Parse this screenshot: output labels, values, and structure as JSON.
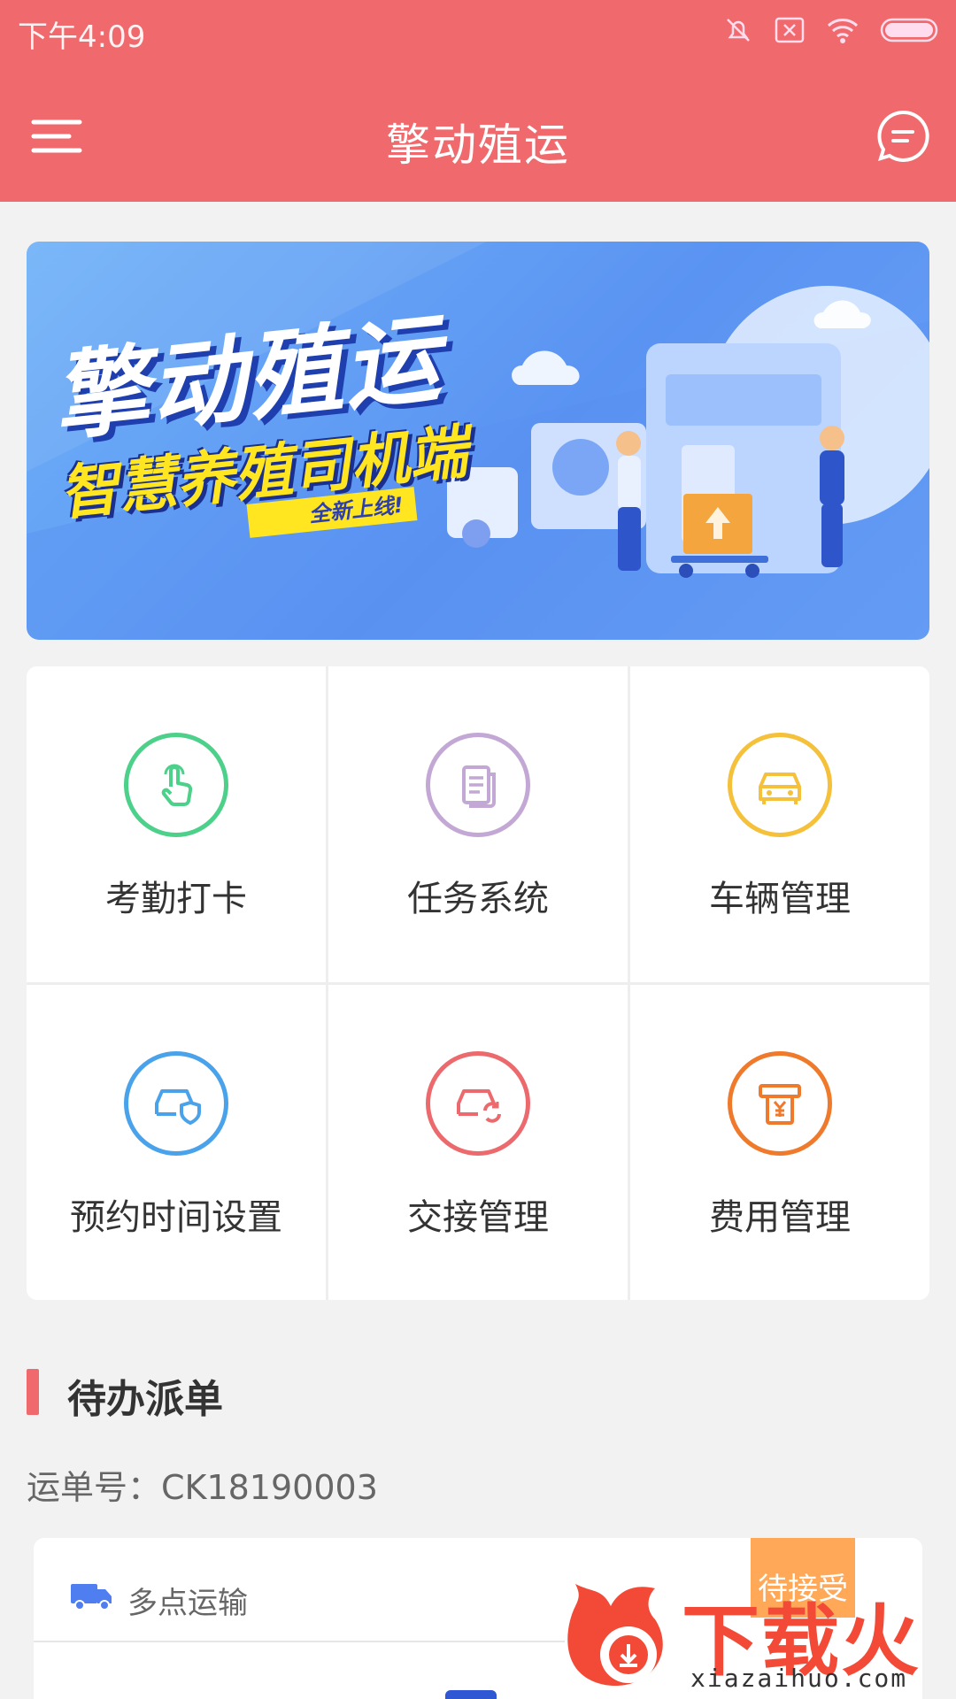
{
  "status_bar": {
    "time": "下午4:09"
  },
  "app_bar": {
    "title": "擎动殖运"
  },
  "banner": {
    "title": "擎动殖运",
    "subtitle": "智慧养殖司机端",
    "tag": "全新上线!"
  },
  "menu": [
    {
      "label": "考勤打卡",
      "icon": "finger-tap-icon",
      "color": "#4cd08a"
    },
    {
      "label": "任务系统",
      "icon": "document-icon",
      "color": "#c3a7d4"
    },
    {
      "label": "车辆管理",
      "icon": "car-icon",
      "color": "#f5c03a"
    },
    {
      "label": "预约时间设置",
      "icon": "car-shield-icon",
      "color": "#4aa3ea"
    },
    {
      "label": "交接管理",
      "icon": "car-sync-icon",
      "color": "#ec6a6d"
    },
    {
      "label": "费用管理",
      "icon": "yuan-receipt-icon",
      "color": "#f07a2c"
    }
  ],
  "pending": {
    "section_title": "待办派单",
    "order_no": "运单号：CK18190003",
    "card": {
      "type": "多点运输",
      "status": "待接受"
    }
  },
  "watermark": {
    "text": "下载火",
    "url": "xiazaihuo.com"
  }
}
